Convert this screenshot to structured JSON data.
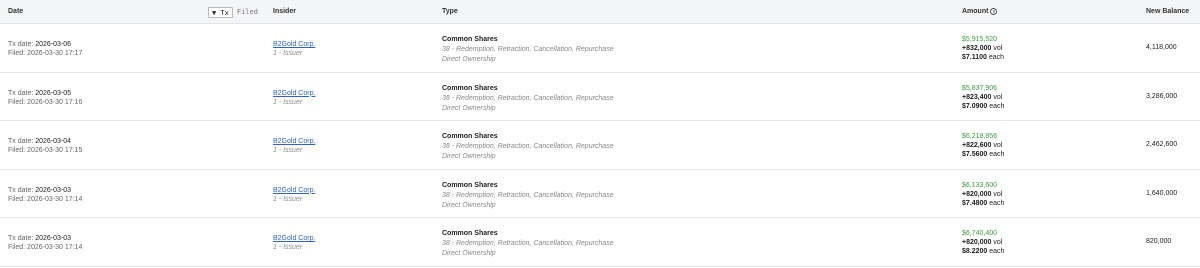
{
  "header": {
    "date": "Date",
    "toggle_tx": "▼ Tx",
    "toggle_filed": "Filed",
    "insider": "Insider",
    "type": "Type",
    "amount": "Amount",
    "new_balance": "New Balance"
  },
  "rows": [
    {
      "tx_prefix": "Tx date: ",
      "tx_date": "2026-03-06",
      "filed": "Filed: 2026-03-30 17:17",
      "insider": "B2Gold Corp.",
      "role": "1 - Issuer",
      "shares": "Common Shares",
      "code": "38 - Redemption, Retraction, Cancellation, Repurchase",
      "ownership": "Direct Ownership",
      "total": "$5,915,520",
      "vol_num": "+832,000",
      "vol_unit": " vol",
      "price": "$7.1100",
      "each": " each",
      "balance": "4,118,000"
    },
    {
      "tx_prefix": "Tx date: ",
      "tx_date": "2026-03-05",
      "filed": "Filed: 2026-03-30 17:16",
      "insider": "B2Gold Corp.",
      "role": "1 - Issuer",
      "shares": "Common Shares",
      "code": "38 - Redemption, Retraction, Cancellation, Repurchase",
      "ownership": "Direct Ownership",
      "total": "$5,837,906",
      "vol_num": "+823,400",
      "vol_unit": " vol",
      "price": "$7.0900",
      "each": " each",
      "balance": "3,286,000"
    },
    {
      "tx_prefix": "Tx date: ",
      "tx_date": "2026-03-04",
      "filed": "Filed: 2026-03-30 17:15",
      "insider": "B2Gold Corp.",
      "role": "1 - Issuer",
      "shares": "Common Shares",
      "code": "38 - Redemption, Retraction, Cancellation, Repurchase",
      "ownership": "Direct Ownership",
      "total": "$6,218,856",
      "vol_num": "+822,600",
      "vol_unit": " vol",
      "price": "$7.5600",
      "each": " each",
      "balance": "2,462,600"
    },
    {
      "tx_prefix": "Tx date: ",
      "tx_date": "2026-03-03",
      "filed": "Filed: 2026-03-30 17:14",
      "insider": "B2Gold Corp.",
      "role": "1 - Issuer",
      "shares": "Common Shares",
      "code": "38 - Redemption, Retraction, Cancellation, Repurchase",
      "ownership": "Direct Ownership",
      "total": "$6,133,600",
      "vol_num": "+820,000",
      "vol_unit": " vol",
      "price": "$7.4800",
      "each": " each",
      "balance": "1,640,000"
    },
    {
      "tx_prefix": "Tx date: ",
      "tx_date": "2026-03-03",
      "filed": "Filed: 2026-03-30 17:14",
      "insider": "B2Gold Corp.",
      "role": "1 - Issuer",
      "shares": "Common Shares",
      "code": "38 - Redemption, Retraction, Cancellation, Repurchase",
      "ownership": "Direct Ownership",
      "total": "$6,740,400",
      "vol_num": "+820,000",
      "vol_unit": " vol",
      "price": "$8.2200",
      "each": " each",
      "balance": "820,000"
    }
  ],
  "icons": {
    "amount_info": "info-icon",
    "balance_info": "info-icon"
  },
  "colors": {
    "link": "#2f63c7",
    "positive_amount": "#3a9d3f",
    "header_bg": "#f4f5f7"
  }
}
